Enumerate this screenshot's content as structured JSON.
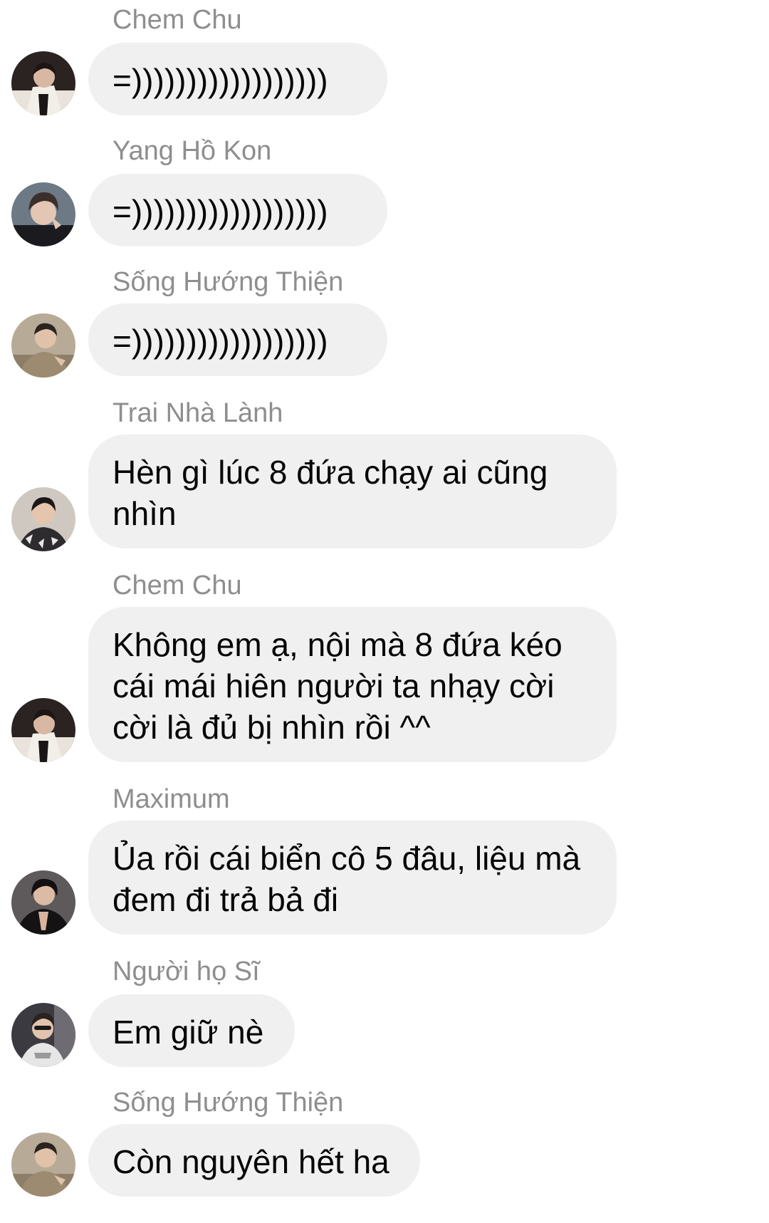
{
  "messages": [
    {
      "sender": "Chem Chu",
      "text": "=))))))))))))))))))",
      "avatar_icon": "avatar-photo-icon"
    },
    {
      "sender": "Yang Hồ Kon",
      "text": "=))))))))))))))))))",
      "avatar_icon": "avatar-photo-icon"
    },
    {
      "sender": "Sống Hướng Thiện",
      "text": "=))))))))))))))))))",
      "avatar_icon": "avatar-photo-icon"
    },
    {
      "sender": "Trai Nhà Lành",
      "text": "Hèn gì lúc 8 đứa chạy ai cũng nhìn",
      "avatar_icon": "avatar-photo-icon"
    },
    {
      "sender": "Chem Chu",
      "text": "Không em ạ, nội mà 8 đứa kéo cái mái hiên người ta nhạy cời cời là đủ bị nhìn rồi ^^",
      "avatar_icon": "avatar-photo-icon"
    },
    {
      "sender": "Maximum",
      "text": "Ủa rồi cái biển cô 5 đâu, liệu mà đem đi trả bả đi",
      "avatar_icon": "avatar-photo-icon"
    },
    {
      "sender": "Người họ Sĩ",
      "text": "Em giữ nè",
      "avatar_icon": "avatar-photo-icon"
    },
    {
      "sender": "Sống Hướng Thiện",
      "text": "Còn nguyên hết ha",
      "avatar_icon": "avatar-photo-icon"
    }
  ],
  "colors": {
    "bubble_bg": "#f0f0f0",
    "sender_text": "#8e8e8e",
    "message_text": "#050505",
    "background": "#ffffff"
  }
}
